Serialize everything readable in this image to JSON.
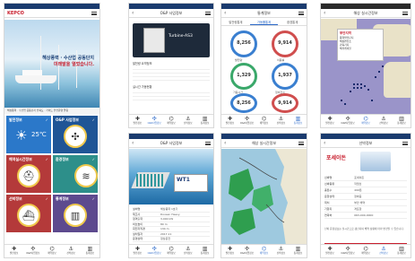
{
  "phone1": {
    "logo": "KEPCO",
    "headline": [
      "해상풍력 · 수산업 공동단지",
      "미래발을 열었습니다."
    ],
    "strip_text": "해상풍력 · 수산업 공동단지 전북도 · 가이드 안전운영 알림",
    "tiles": [
      {
        "title": "발전정보",
        "icon": "☀",
        "value": "25℃"
      },
      {
        "title": "O&P 사업정보",
        "icon": "✣",
        "value": ""
      },
      {
        "title": "해역실시간정보",
        "icon": "⛑",
        "value": ""
      },
      {
        "title": "환경정보",
        "icon": "≋",
        "value": ""
      },
      {
        "title": "선박정보",
        "icon": "⛴",
        "value": ""
      },
      {
        "title": "통계정보",
        "icon": "▥",
        "value": ""
      }
    ]
  },
  "phone2": {
    "title": "O&P 사업정보",
    "card_name": "Turbine-AS3",
    "sec1": "발전량 요약정보",
    "sec2": "실시간 가동현황"
  },
  "phone3": {
    "title": "통계정보",
    "tabs": [
      "발전량통계",
      "가동률통계",
      "환경통계"
    ],
    "gauges": [
      {
        "value": "8,256",
        "label": "발전량"
      },
      {
        "value": "9,914",
        "label": "이용률"
      },
      {
        "value": "1,329",
        "label": "가동시간"
      },
      {
        "value": "1,937",
        "label": "정비건수"
      },
      {
        "value": "8,256",
        "label": "누적발전"
      },
      {
        "value": "9,914",
        "label": "누적가동"
      }
    ]
  },
  "phone4": {
    "title": "해상 실시간정보",
    "legend_title": "부안지역",
    "legend_items": [
      "풍력발전단지",
      "해상변전소",
      "관측기지",
      "해저케이블"
    ]
  },
  "phone5": {
    "title": "O&P 사업정보",
    "panel_title": "WT1",
    "rows": [
      {
        "k": "설비명",
        "v": "해상풍력 1호기"
      },
      {
        "k": "제조사",
        "v": "Doosan Heavy"
      },
      {
        "k": "정격출력",
        "v": "3,000 kW"
      },
      {
        "k": "허브높이",
        "v": "80 m"
      },
      {
        "k": "회전자직경",
        "v": "134 m"
      },
      {
        "k": "설치일자",
        "v": "2017.11"
      },
      {
        "k": "운영상태",
        "v": "정상운전"
      }
    ]
  },
  "phone6": {
    "title": "해상 실시간정보"
  },
  "phone7": {
    "title": "선박정보",
    "heading": "포세이돈",
    "rows": [
      {
        "k": "선박명",
        "v": "포세이돈"
      },
      {
        "k": "선박종류",
        "v": "작업선"
      },
      {
        "k": "총톤수",
        "v": "499톤"
      },
      {
        "k": "운항상태",
        "v": "정박중"
      },
      {
        "k": "위치",
        "v": "부안 해역"
      },
      {
        "k": "기항지",
        "v": "격포항"
      },
      {
        "k": "연락처",
        "v": "063-000-0000"
      }
    ],
    "note": "선박 운항정보는 실시간으로 갱신되며 해역 상황에 따라 변경될 수 있습니다.",
    "button": "상세정보 보기"
  },
  "nav": [
    "발전정보",
    "O&P사업정보",
    "해역정보",
    "선박정보",
    "통계정보"
  ],
  "nav_icons": [
    "✚",
    "✣",
    "⌬",
    "⚓",
    "▥"
  ]
}
